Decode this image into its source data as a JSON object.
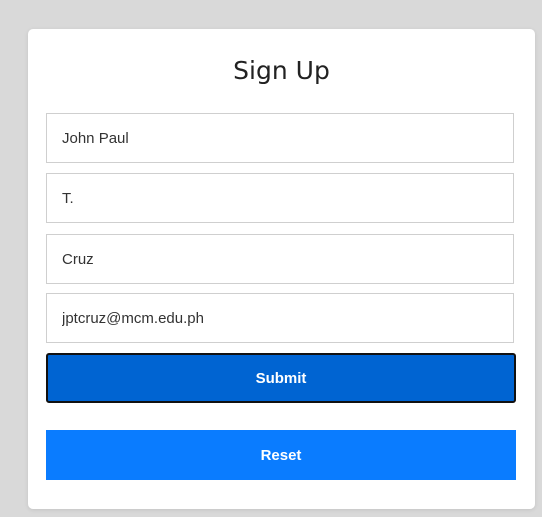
{
  "form": {
    "title": "Sign Up",
    "first_name": {
      "value": "John Paul",
      "placeholder": ""
    },
    "middle_initial": {
      "value": "T.",
      "placeholder": ""
    },
    "last_name": {
      "value": "Cruz",
      "placeholder": ""
    },
    "email": {
      "value": "jptcruz@mcm.edu.ph",
      "placeholder": ""
    },
    "submit_label": "Submit",
    "reset_label": "Reset"
  },
  "colors": {
    "background": "#d9d9d9",
    "card": "#ffffff",
    "submit_button": "#0064d2",
    "reset_button": "#0a7cff"
  }
}
